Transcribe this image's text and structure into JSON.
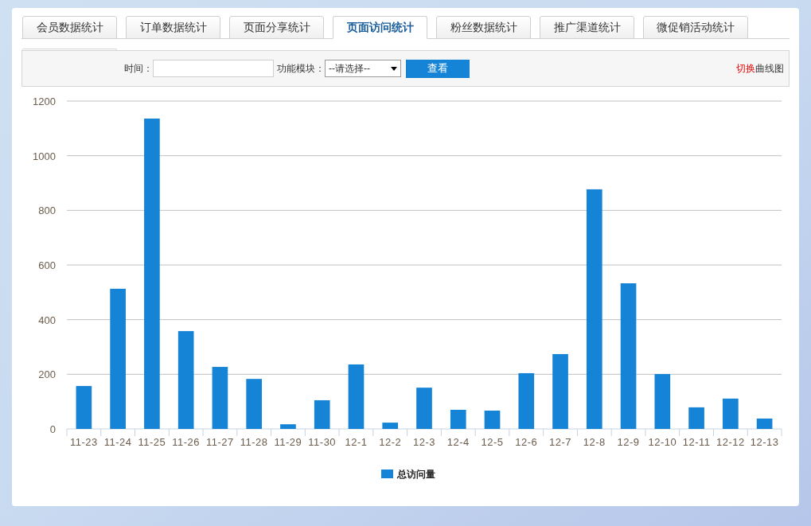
{
  "tabs": [
    {
      "label": "会员数据统计",
      "selected": false
    },
    {
      "label": "订单数据统计",
      "selected": false
    },
    {
      "label": "页面分享统计",
      "selected": false
    },
    {
      "label": "页面访问统计",
      "selected": true
    },
    {
      "label": "粉丝数据统计",
      "selected": false
    },
    {
      "label": "推广渠道统计",
      "selected": false
    },
    {
      "label": "微促销活动统计",
      "selected": false
    }
  ],
  "filter": {
    "time_label": "时间：",
    "module_label": "功能模块：",
    "module_select": "--请选择--",
    "view_button": "查看",
    "toggle_link": {
      "action": "切换",
      "target": "曲线图"
    }
  },
  "chart_data": {
    "type": "bar",
    "categories": [
      "11-23",
      "11-24",
      "11-25",
      "11-26",
      "11-27",
      "11-28",
      "11-29",
      "11-30",
      "12-1",
      "12-2",
      "12-3",
      "12-4",
      "12-5",
      "12-6",
      "12-7",
      "12-8",
      "12-9",
      "12-10",
      "12-11",
      "12-12",
      "12-13"
    ],
    "series": [
      {
        "name": "总访问量",
        "color": "#1584d6",
        "values": [
          157,
          513,
          1136,
          358,
          227,
          183,
          17,
          105,
          236,
          23,
          151,
          70,
          67,
          204,
          274,
          877,
          533,
          201,
          79,
          111,
          38
        ]
      }
    ],
    "grid": true,
    "ylim": [
      0,
      1200
    ],
    "yticks": [
      0,
      200,
      400,
      600,
      800,
      1000,
      1200
    ]
  }
}
